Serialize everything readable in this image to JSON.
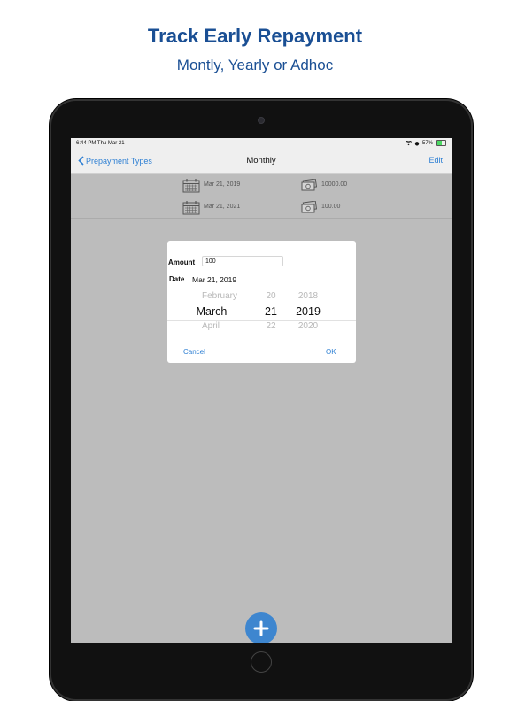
{
  "promo": {
    "title": "Track Early Repayment",
    "subtitle": "Montly, Yearly or Adhoc"
  },
  "statusbar": {
    "time": "6:44 PM   Thu Mar 21",
    "battery": "57%",
    "battery_level": 0.57
  },
  "navbar": {
    "back_label": "Prepayment Types",
    "title": "Monthly",
    "edit_label": "Edit"
  },
  "repayments": [
    {
      "date": "Mar 21, 2019",
      "amount": "10000.00"
    },
    {
      "date": "Mar 21, 2021",
      "amount": "100.00"
    }
  ],
  "dialog": {
    "amount_label": "Amount",
    "amount_value": "100",
    "date_label": "Date",
    "date_value": "Mar 21, 2019",
    "picker": {
      "month": {
        "prev": "February",
        "selected": "March",
        "next": "April"
      },
      "day": {
        "prev": "20",
        "selected": "21",
        "next": "22"
      },
      "year": {
        "prev": "2018",
        "selected": "2019",
        "next": "2020"
      }
    },
    "cancel_label": "Cancel",
    "ok_label": "OK"
  },
  "icons": {
    "back": "chevron-left-icon",
    "calendar": "calendar-icon",
    "cash": "cash-icon",
    "add": "plus-icon",
    "wifi": "wifi-icon"
  },
  "colors": {
    "accent": "#2d7fd3",
    "promo_text": "#1a4f94",
    "fab": "#3e86cf",
    "screen_dim": "#bcbcbc"
  }
}
